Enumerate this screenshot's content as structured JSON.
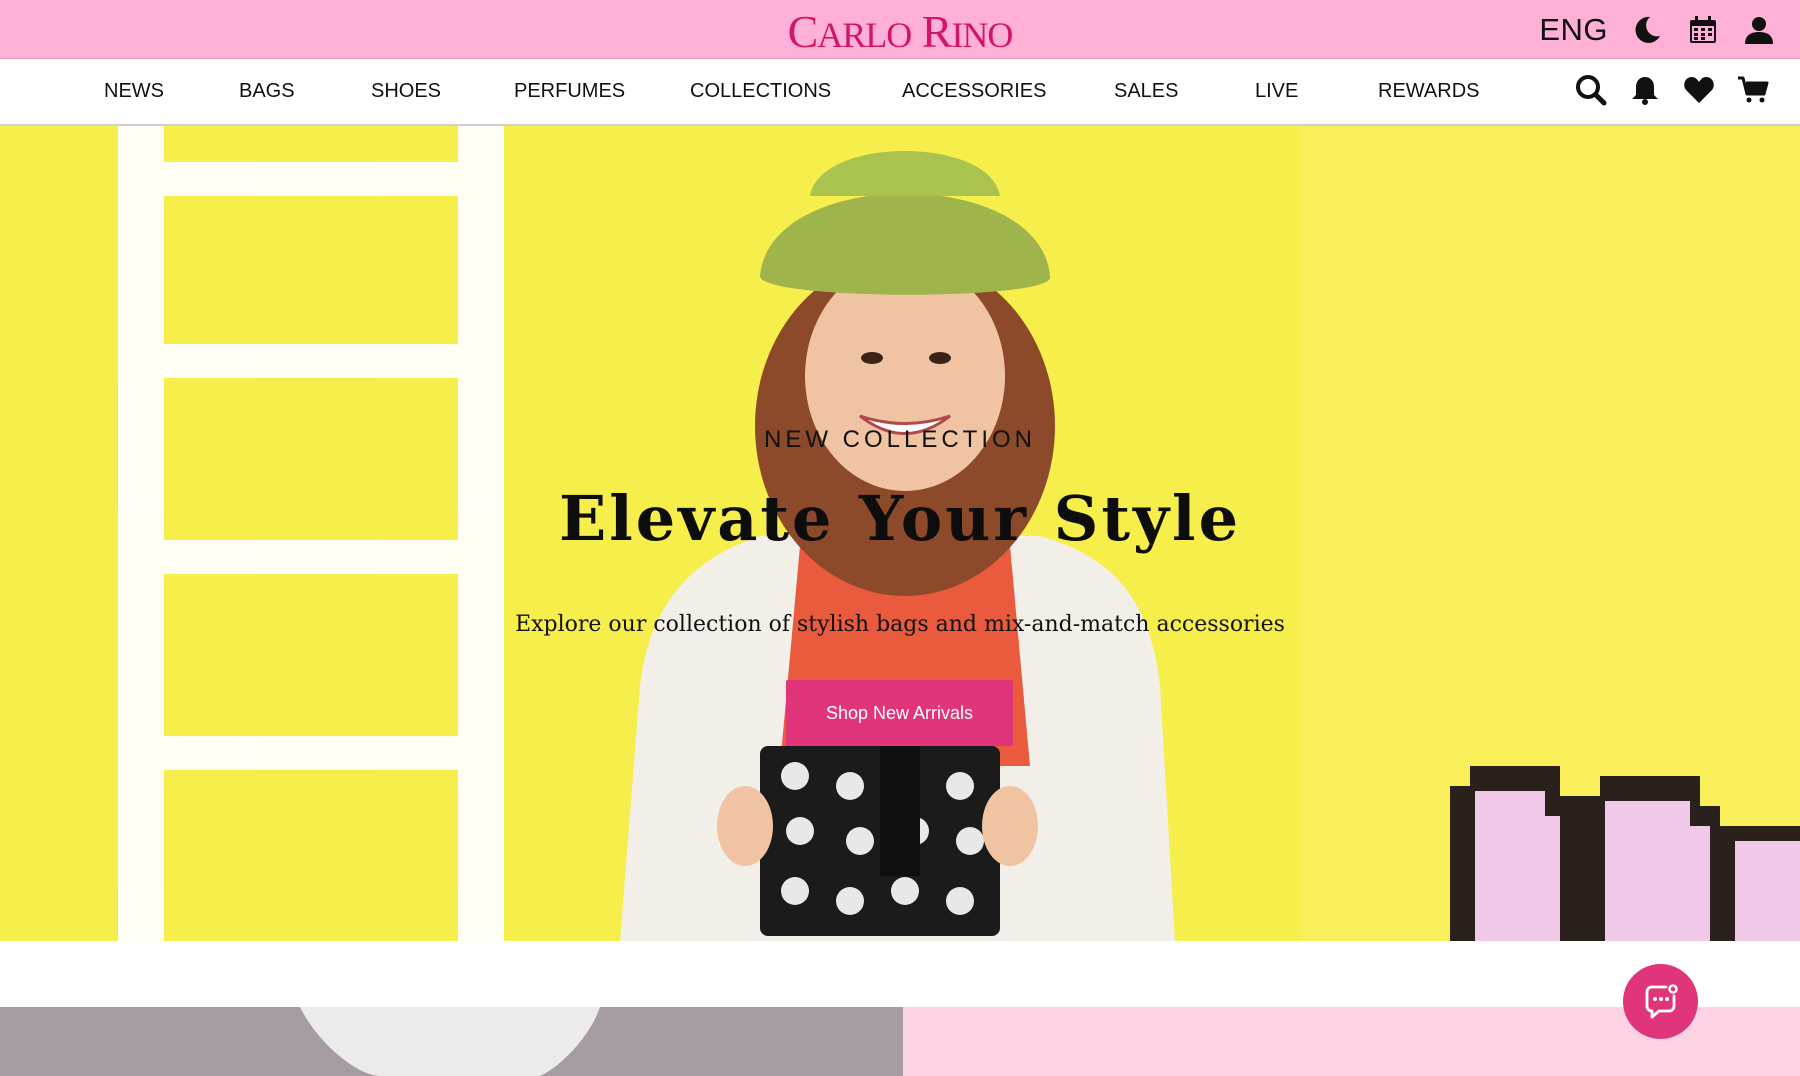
{
  "brand": {
    "logo_text_part1_big": "C",
    "logo_text_part1_small": "ARLO",
    "logo_text_part2_big": "R",
    "logo_text_part2_small": "INO",
    "color": "#d4146a"
  },
  "header": {
    "language": "ENG",
    "icons": [
      "moon-icon",
      "calendar-icon",
      "user-icon"
    ],
    "background": "#ffb0d6"
  },
  "nav": {
    "items": [
      {
        "label": "NEWS"
      },
      {
        "label": "BAGS"
      },
      {
        "label": "SHOES"
      },
      {
        "label": "PERFUMES"
      },
      {
        "label": "COLLECTIONS"
      },
      {
        "label": "ACCESSORIES"
      },
      {
        "label": "SALES"
      },
      {
        "label": "LIVE"
      },
      {
        "label": "REWARDS"
      }
    ],
    "icons": [
      "search-icon",
      "bell-icon",
      "heart-icon",
      "cart-icon"
    ]
  },
  "hero": {
    "eyebrow": "NEW  COLLECTION",
    "title": "Elevate Your Style",
    "subtitle": "Explore our collection of stylish bags and mix-and-match accessories",
    "cta_label": "Shop New Arrivals",
    "background": "#f6ee4a",
    "accent": "#e0357a"
  },
  "chat": {
    "icon": "chat-bubble-icon"
  }
}
